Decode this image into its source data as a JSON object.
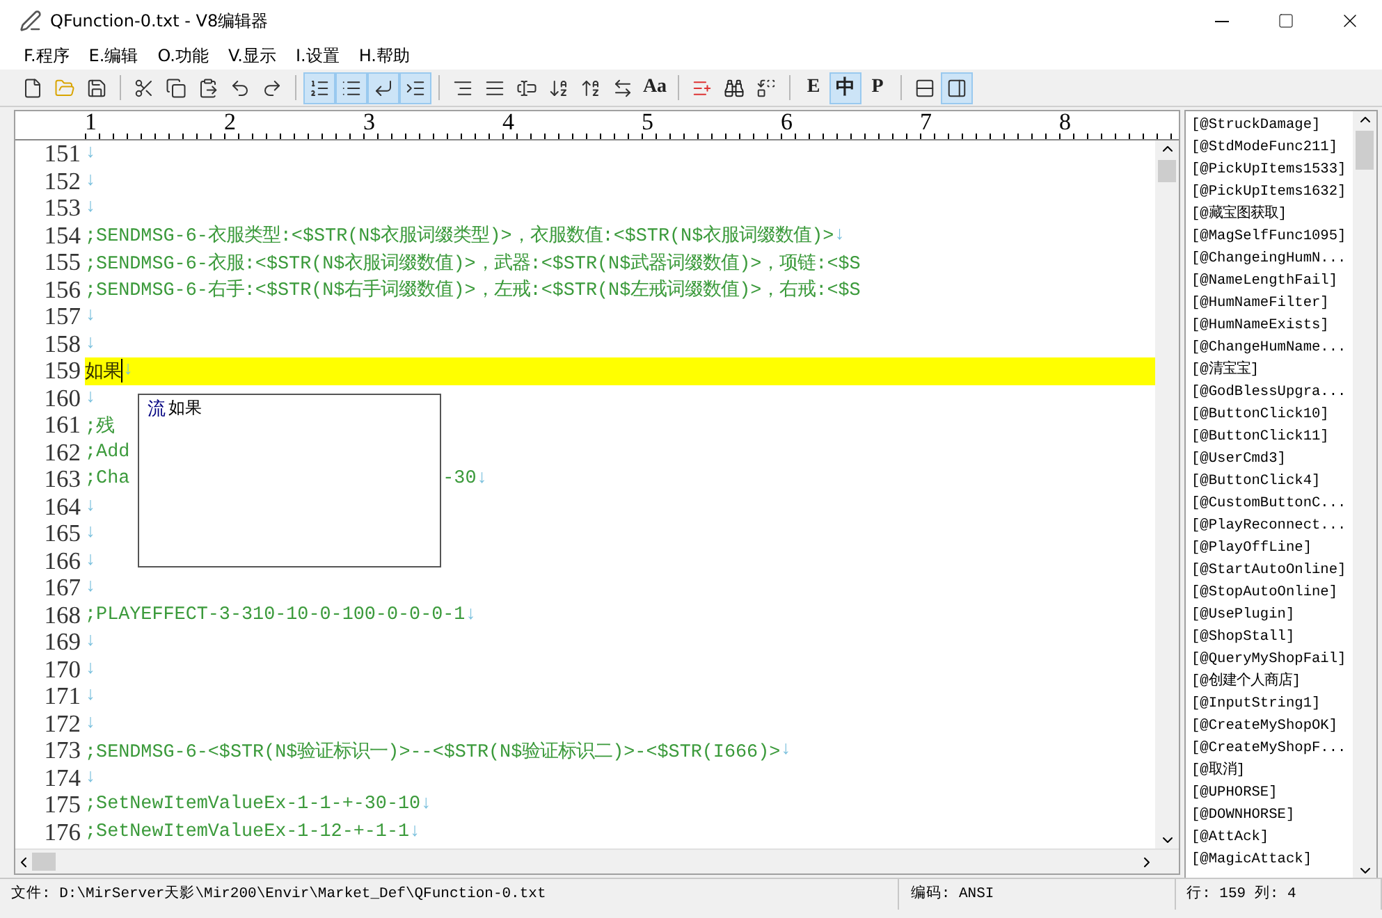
{
  "window": {
    "title": "QFunction-0.txt - V8编辑器"
  },
  "menu": [
    "F.程序",
    "E.编辑",
    "O.功能",
    "V.显示",
    "I.设置",
    "H.帮助"
  ],
  "toolbar": [
    [
      {
        "kind": "new",
        "selected": false
      },
      {
        "kind": "open",
        "selected": false
      },
      {
        "kind": "save",
        "selected": false
      }
    ],
    [
      {
        "kind": "cut",
        "selected": false
      },
      {
        "kind": "copy",
        "selected": false
      },
      {
        "kind": "paste",
        "selected": false
      },
      {
        "kind": "undo",
        "selected": false
      },
      {
        "kind": "redo",
        "selected": false
      }
    ],
    [
      {
        "kind": "line-numbers",
        "selected": true
      },
      {
        "kind": "list",
        "selected": true
      },
      {
        "kind": "wrap",
        "selected": true
      },
      {
        "kind": "indent",
        "selected": true
      }
    ],
    [
      {
        "kind": "align-right",
        "selected": false
      },
      {
        "kind": "align-justify",
        "selected": false
      },
      {
        "kind": "text-box",
        "selected": false
      },
      {
        "kind": "case-down",
        "selected": false
      },
      {
        "kind": "case-up",
        "selected": false
      },
      {
        "kind": "case-swap",
        "selected": false
      },
      {
        "kind": "text",
        "label": "Aa",
        "selected": false
      }
    ],
    [
      {
        "kind": "insert",
        "selected": false
      },
      {
        "kind": "find",
        "selected": false
      },
      {
        "kind": "replace",
        "selected": false
      }
    ],
    [
      {
        "kind": "text",
        "label": "E",
        "selected": false
      },
      {
        "kind": "text",
        "label": "中",
        "selected": true
      },
      {
        "kind": "text",
        "label": "P",
        "selected": false
      }
    ],
    [
      {
        "kind": "rows",
        "selected": false
      },
      {
        "kind": "panel",
        "selected": true
      }
    ]
  ],
  "ruler": [
    "1",
    "2",
    "3",
    "4",
    "5",
    "6",
    "7",
    "8"
  ],
  "lines": [
    {
      "number": "151",
      "eol": "↓",
      "current": false
    },
    {
      "number": "152",
      "eol": "↓",
      "current": false
    },
    {
      "number": "153",
      "eol": "↓",
      "current": false
    },
    {
      "number": "154",
      "text": ";SENDMSG-6-衣服类型:<$STR(N$衣服词缀类型)>，衣服数值:<$STR(N$衣服词缀数值)>",
      "eol": "↓",
      "current": false
    },
    {
      "number": "155",
      "text": ";SENDMSG-6-衣服:<$STR(N$衣服词缀数值)>，武器:<$STR(N$武器词缀数值)>，项链:<$S",
      "current": false
    },
    {
      "number": "156",
      "text": ";SENDMSG-6-右手:<$STR(N$右手词缀数值)>，左戒:<$STR(N$左戒词缀数值)>，右戒:<$S",
      "current": false
    },
    {
      "number": "157",
      "eol": "↓",
      "current": false
    },
    {
      "number": "158",
      "eol": "↓",
      "current": false
    },
    {
      "number": "159",
      "text": "如果",
      "eol": "↓",
      "current": true
    },
    {
      "number": "160",
      "eol": "↓",
      "current": false
    },
    {
      "number": "161",
      "text": ";残",
      "current": false
    },
    {
      "number": "162",
      "text": ";Add",
      "current": false
    },
    {
      "number": "163",
      "text": ";Cha",
      "tail": "-30",
      "eol": "↓",
      "current": false
    },
    {
      "number": "164",
      "eol": "↓",
      "current": false
    },
    {
      "number": "165",
      "eol": "↓",
      "current": false
    },
    {
      "number": "166",
      "eol": "↓",
      "current": false
    },
    {
      "number": "167",
      "eol": "↓",
      "current": false
    },
    {
      "number": "168",
      "text": ";PLAYEFFECT-3-310-10-0-100-0-0-0-1",
      "eol": "↓",
      "current": false
    },
    {
      "number": "169",
      "eol": "↓",
      "current": false
    },
    {
      "number": "170",
      "eol": "↓",
      "current": false
    },
    {
      "number": "171",
      "eol": "↓",
      "current": false
    },
    {
      "number": "172",
      "eol": "↓",
      "current": false
    },
    {
      "number": "173",
      "text": ";SENDMSG-6-<$STR(N$验证标识一)>--<$STR(N$验证标识二)>-<$STR(I666)>",
      "eol": "↓",
      "current": false
    },
    {
      "number": "174",
      "eol": "↓",
      "current": false
    },
    {
      "number": "175",
      "text": ";SetNewItemValueEx-1-1-+-30-10",
      "eol": "↓",
      "current": false
    },
    {
      "number": "176",
      "text": ";SetNewItemValueEx-1-12-+-1-1",
      "eol": "↓",
      "current": false
    }
  ],
  "autocomplete": {
    "items": [
      {
        "badge": "流",
        "label": "如果"
      }
    ]
  },
  "labels": [
    "[@StruckDamage]",
    "[@StdModeFunc211]",
    "[@PickUpItems1533]",
    "[@PickUpItems1632]",
    "[@藏宝图获取]",
    "[@MagSelfFunc1095]",
    "[@ChangeingHumN...",
    "[@NameLengthFail]",
    "[@HumNameFilter]",
    "[@HumNameExists]",
    "[@ChangeHumName...",
    "[@清宝宝]",
    "[@GodBlessUpgra...",
    "[@ButtonClick10]",
    "[@ButtonClick11]",
    "[@UserCmd3]",
    "[@ButtonClick4]",
    "[@CustomButtonC...",
    "[@PlayReconnect...",
    "[@PlayOffLine]",
    "[@StartAutoOnline]",
    "[@StopAutoOnline]",
    "[@UsePlugin]",
    "[@ShopStall]",
    "[@QueryMyShopFail]",
    "[@创建个人商店]",
    "[@InputString1]",
    "[@CreateMyShopOK]",
    "[@CreateMyShopF...",
    "[@取消]",
    "[@UPHORSE]",
    "[@DOWNHORSE]",
    "[@AttAck]",
    "[@MagicAttack]"
  ],
  "status_bar": {
    "file": "文件: D:\\MirServer天影\\Mir200\\Envir\\Market_Def\\QFunction-0.txt",
    "encoding": "编码: ANSI",
    "position": "行: 159  列: 4"
  }
}
